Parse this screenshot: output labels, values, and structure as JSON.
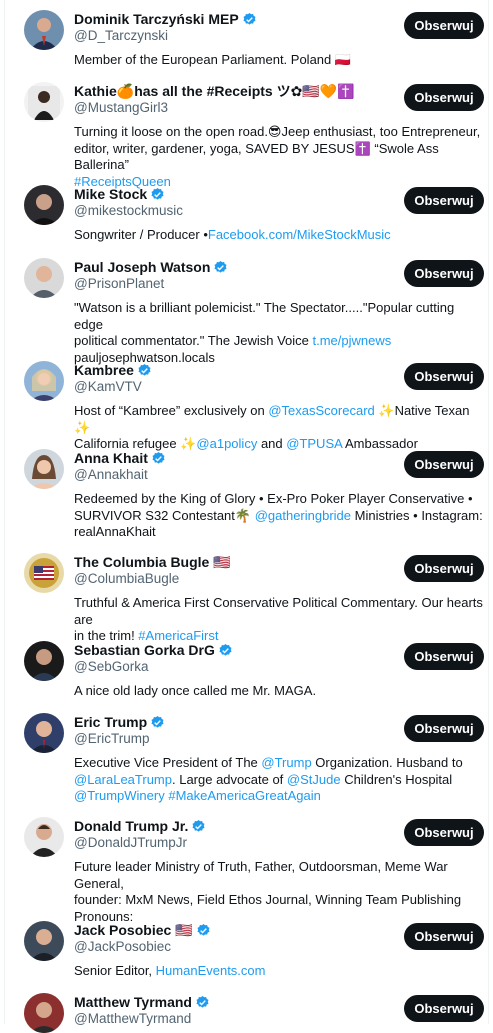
{
  "follow_label": "Obserwuj",
  "accounts": [
    {
      "name": "Dominik Tarczyński MEP",
      "handle": "@D_Tarczynski",
      "verified": true,
      "bio": [
        "Member of the European Parliament. Poland 🇵🇱"
      ]
    },
    {
      "name": "Kathie🍊has all the #Receipts ツ✿🇺🇸🧡✝️",
      "handle": "@MustangGirl3",
      "verified": false,
      "bio": [
        "Turning it loose on the open road.😎Jeep enthusiast, too Entrepreneur,",
        "editor, writer, gardener, yoga, SAVED BY JESUS✝️ “Swole Ass Ballerina”",
        "#ReceiptsQueen"
      ]
    },
    {
      "name": "Mike Stock",
      "handle": "@mikestockmusic",
      "verified": true,
      "bio_prefix": "Songwriter / Producer •",
      "bio_link": "Facebook.com/MikeStockMusic"
    },
    {
      "name": "Paul Joseph Watson",
      "handle": "@PrisonPlanet",
      "verified": true,
      "bio": [
        "\"Watson is a brilliant polemicist.\" The Spectator.....\"Popular cutting edge",
        "political commentator.\" The Jewish Voice ",
        "pauljosephwatson.locals"
      ],
      "bio_link": "t.me/pjwnews"
    },
    {
      "name": "Kambree",
      "handle": "@KamVTV",
      "verified": true,
      "bio_parts": [
        "Host of “Kambree” exclusively on ",
        "@TexasScorecard",
        " ✨Native Texan ✨",
        "California refugee ✨",
        "@a1policy",
        " and ",
        "@TPUSA",
        " Ambassador"
      ]
    },
    {
      "name": "Anna Khait",
      "handle": "@Annakhait",
      "verified": true,
      "bio_parts": [
        "Redeemed by the King of Glory • Ex-Pro Poker Player Conservative •",
        "SURVIVOR S32 Contestant🌴 ",
        "@gatheringbride",
        " Ministries • Instagram:",
        "realAnnaKhait"
      ]
    },
    {
      "name": "The Columbia Bugle 🇺🇸",
      "handle": "@ColumbiaBugle",
      "verified": false,
      "bio_parts": [
        "Truthful & America First Conservative Political Commentary. Our hearts are",
        "in the trim! ",
        "#AmericaFirst"
      ]
    },
    {
      "name": "Sebastian Gorka DrG",
      "handle": "@SebGorka",
      "verified": true,
      "bio": [
        "A nice old lady once called me Mr. MAGA."
      ]
    },
    {
      "name": "Eric Trump",
      "handle": "@EricTrump",
      "verified": true,
      "bio_parts": [
        "Executive Vice President of The ",
        "@Trump",
        " Organization. Husband to",
        "@LaraLeaTrump",
        ". Large advocate of ",
        "@StJude",
        " Children's Hospital",
        "@TrumpWinery",
        " ",
        "#MakeAmericaGreatAgain"
      ]
    },
    {
      "name": "Donald Trump Jr.",
      "handle": "@DonaldJTrumpJr",
      "verified": true,
      "bio": [
        "Future leader Ministry of Truth, Father, Outdoorsman, Meme War General,",
        "founder: MxM News, Field Ethos Journal, Winning Team Publishing",
        "Pronouns:"
      ]
    },
    {
      "name": "Jack Posobiec 🇺🇸",
      "handle": "@JackPosobiec",
      "verified": true,
      "bio_prefix": "Senior Editor, ",
      "bio_link": "HumanEvents.com"
    },
    {
      "name": "Matthew Tyrmand",
      "handle": "@MatthewTyrmand",
      "verified": true
    }
  ],
  "colors": {
    "link": "#1d9bf0",
    "button_bg": "#0f1419",
    "muted": "#536471",
    "verified": "#1d9bf0"
  }
}
